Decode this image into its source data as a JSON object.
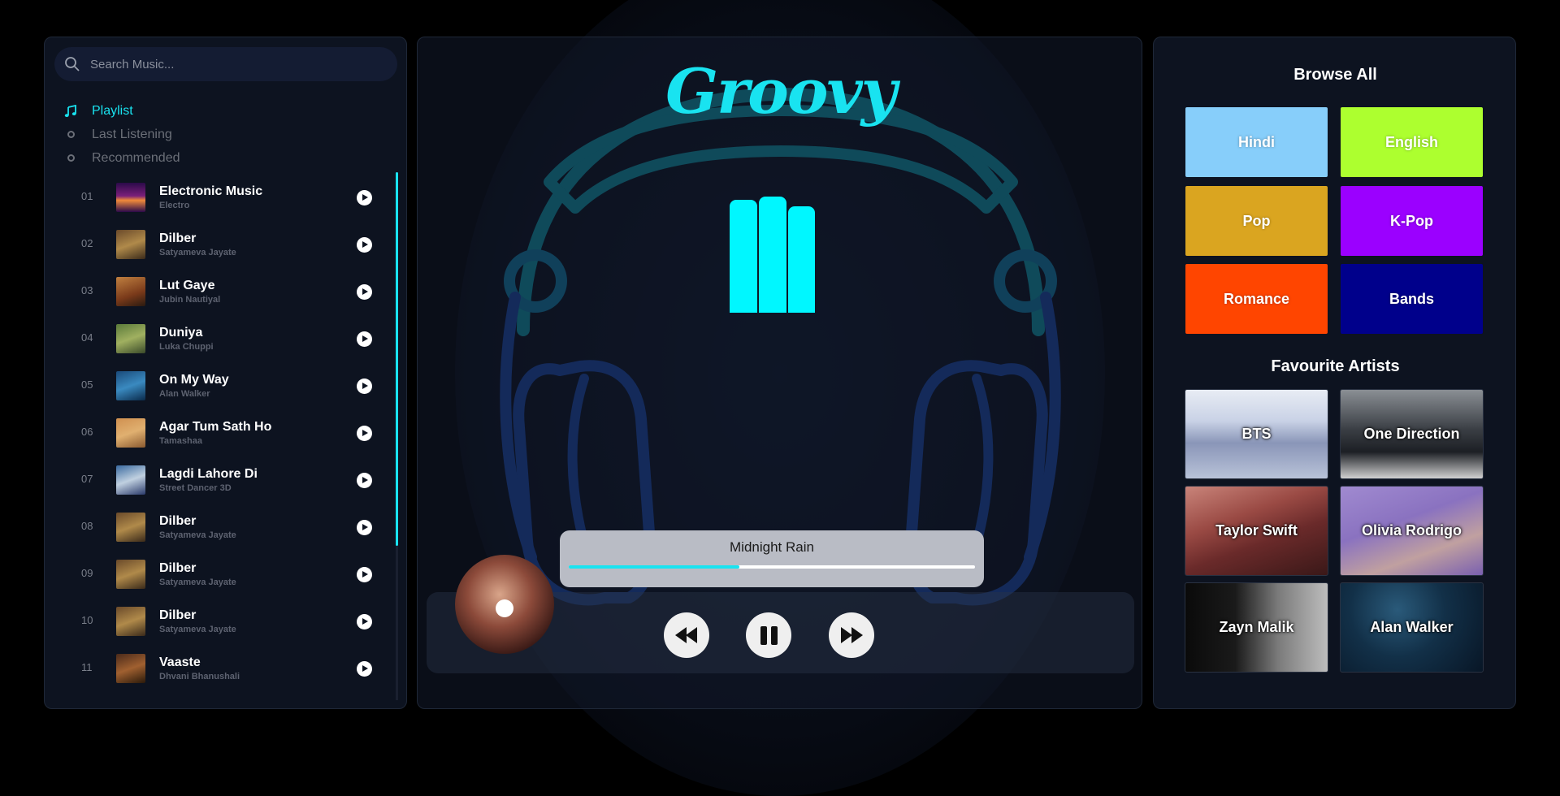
{
  "search": {
    "placeholder": "Search Music..."
  },
  "nav": [
    {
      "label": "Playlist",
      "active": true,
      "icon": "music-note-icon"
    },
    {
      "label": "Last Listening",
      "active": false,
      "icon": "circle-icon"
    },
    {
      "label": "Recommended",
      "active": false,
      "icon": "circle-icon"
    }
  ],
  "playlist": [
    {
      "num": "01",
      "title": "Electronic Music",
      "artist": "Electro"
    },
    {
      "num": "02",
      "title": "Dilber",
      "artist": "Satyameva Jayate"
    },
    {
      "num": "03",
      "title": "Lut Gaye",
      "artist": "Jubin Nautiyal"
    },
    {
      "num": "04",
      "title": "Duniya",
      "artist": "Luka Chuppi"
    },
    {
      "num": "05",
      "title": "On My Way",
      "artist": "Alan Walker"
    },
    {
      "num": "06",
      "title": "Agar Tum Sath Ho",
      "artist": "Tamashaa"
    },
    {
      "num": "07",
      "title": "Lagdi Lahore Di",
      "artist": "Street Dancer 3D"
    },
    {
      "num": "08",
      "title": "Dilber",
      "artist": "Satyameva Jayate"
    },
    {
      "num": "09",
      "title": "Dilber",
      "artist": "Satyameva Jayate"
    },
    {
      "num": "10",
      "title": "Dilber",
      "artist": "Satyameva Jayate"
    },
    {
      "num": "11",
      "title": "Vaaste",
      "artist": "Dhvani Bhanushali"
    }
  ],
  "player": {
    "logo": "Groovy",
    "now_playing": "Midnight Rain",
    "progress": 0.42,
    "accent": "#19e3f0"
  },
  "browse": {
    "title": "Browse All",
    "genres": [
      {
        "label": "Hindi",
        "color": "#87cefa"
      },
      {
        "label": "English",
        "color": "#adff2f"
      },
      {
        "label": "Pop",
        "color": "#daa520"
      },
      {
        "label": "K-Pop",
        "color": "#9b00ff"
      },
      {
        "label": "Romance",
        "color": "#ff4500"
      },
      {
        "label": "Bands",
        "color": "#00008b"
      }
    ]
  },
  "artists": {
    "title": "Favourite Artists",
    "items": [
      {
        "label": "BTS"
      },
      {
        "label": "One Direction"
      },
      {
        "label": "Taylor Swift"
      },
      {
        "label": "Olivia Rodrigo"
      },
      {
        "label": "Zayn Malik"
      },
      {
        "label": "Alan Walker"
      }
    ]
  }
}
